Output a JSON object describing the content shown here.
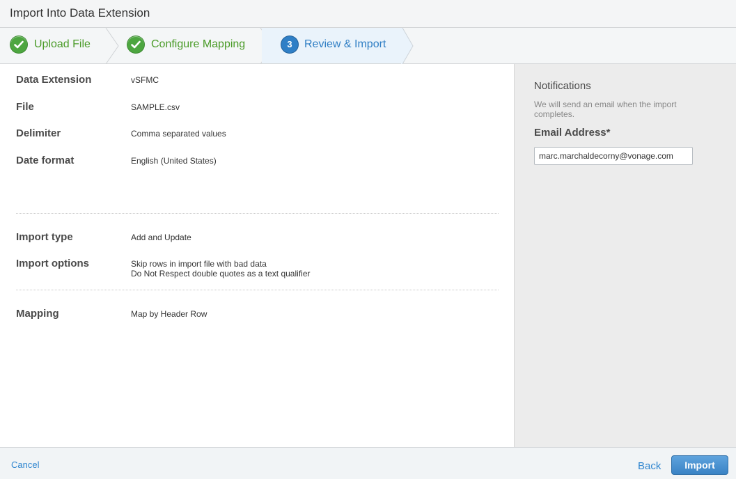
{
  "window": {
    "title": "Import Into Data Extension"
  },
  "steps": [
    {
      "label": "Upload File",
      "state": "done",
      "icon": "check-icon"
    },
    {
      "label": "Configure Mapping",
      "state": "done",
      "icon": "check-icon"
    },
    {
      "label": "Review & Import",
      "state": "active",
      "number": "3"
    }
  ],
  "summary": {
    "data_extension": {
      "label": "Data Extension",
      "value": "vSFMC"
    },
    "file": {
      "label": "File",
      "value": "SAMPLE.csv"
    },
    "delimiter": {
      "label": "Delimiter",
      "value": "Comma separated values"
    },
    "date_format": {
      "label": "Date format",
      "value": "English (United States)"
    },
    "import_type": {
      "label": "Import type",
      "value": "Add and Update"
    },
    "import_options": {
      "label": "Import options",
      "values": [
        "Skip rows in import file with bad data",
        "Do Not Respect double quotes as a text qualifier"
      ]
    },
    "mapping": {
      "label": "Mapping",
      "value": "Map by Header Row"
    }
  },
  "notifications": {
    "title": "Notifications",
    "description": "We will send an email when the import completes.",
    "email_label": "Email Address*",
    "email_value": "marc.marchaldecorny@vonage.com"
  },
  "footer": {
    "cancel": "Cancel",
    "back": "Back",
    "import": "Import"
  },
  "colors": {
    "done": "#4a9b28",
    "active": "#2f7ec4",
    "link": "#2e85cf",
    "primary_button": "#3a83c5"
  }
}
